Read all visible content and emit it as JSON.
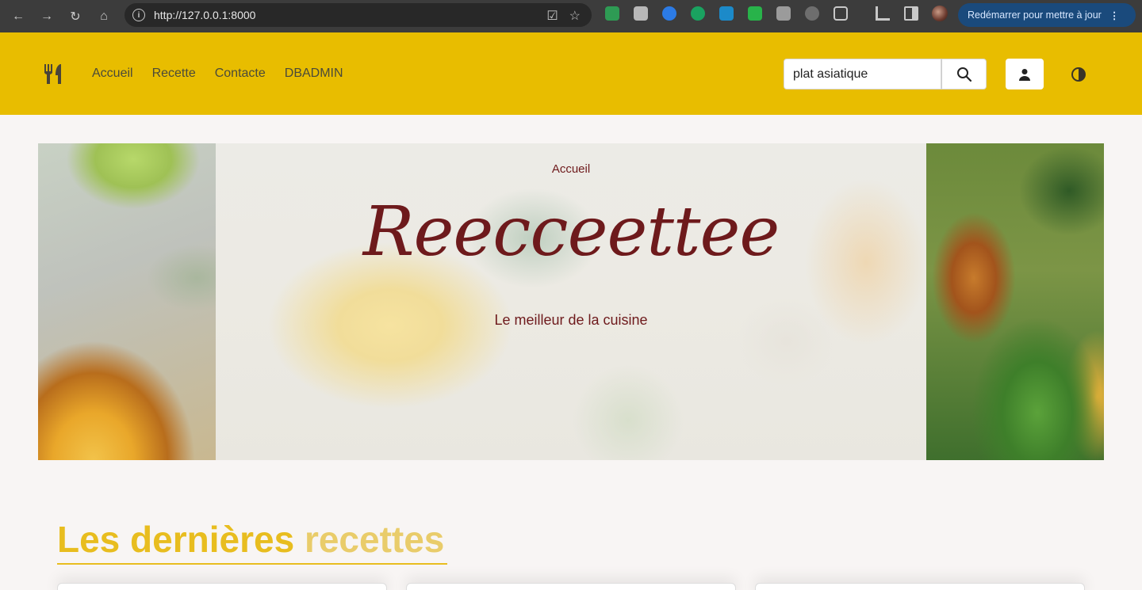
{
  "browser": {
    "url": "http://127.0.0.1:8000",
    "restart_label": "Redémarrer pour mettre à jour"
  },
  "navbar": {
    "logo_icon": "fork-knife-icon",
    "links": [
      "Accueil",
      "Recette",
      "Contacte",
      "DBADMIN"
    ],
    "search_value": "plat asiatique",
    "brand_color": "#e8bd00"
  },
  "hero": {
    "breadcrumb": "Accueil",
    "title": "Reecceettee",
    "subtitle": "Le meilleur de la cuisine",
    "text_color": "#6e1a1c"
  },
  "section": {
    "title_part1": "Les dernières ",
    "title_part2": "recettes",
    "title_color": "#e8bd1f"
  }
}
